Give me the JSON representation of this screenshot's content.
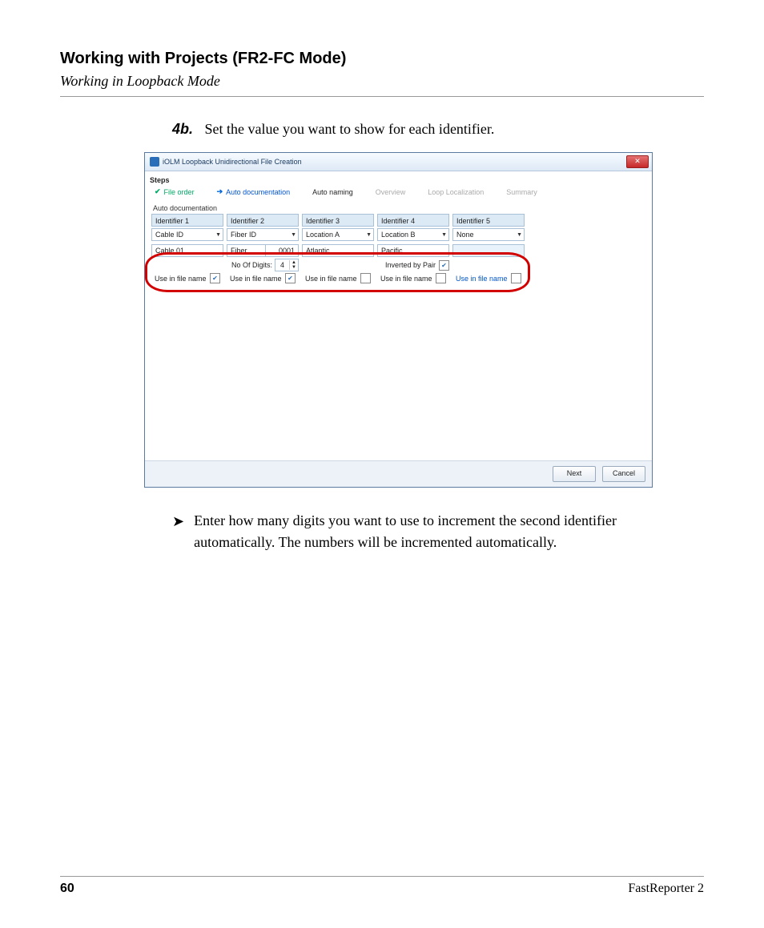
{
  "page": {
    "chapter": "Working with Projects (FR2-FC Mode)",
    "section": "Working in Loopback Mode",
    "step_number": "4b.",
    "step_text": "Set the value you want to show for each identifier.",
    "bullet_text": "Enter how many digits you want to use to increment the second identifier automatically. The numbers will be incremented automatically.",
    "page_number": "60",
    "product": "FastReporter 2"
  },
  "dialog": {
    "title": "iOLM Loopback Unidirectional File Creation",
    "steps_label": "Steps",
    "steps": {
      "file_order": "File order",
      "auto_doc": "Auto documentation",
      "auto_naming": "Auto naming",
      "overview": "Overview",
      "loop_loc": "Loop Localization",
      "summary": "Summary"
    },
    "group": "Auto documentation",
    "headers": {
      "id1": "Identifier 1",
      "id2": "Identifier 2",
      "id3": "Identifier 3",
      "id4": "Identifier 4",
      "id5": "Identifier 5"
    },
    "combo": {
      "c1": "Cable ID",
      "c2": "Fiber ID",
      "c3": "Location A",
      "c4": "Location B",
      "c5": "None"
    },
    "vals": {
      "v1": "Cable 01",
      "v2a": "Fiber",
      "v2b": "0001",
      "v3": "Atlantic",
      "v4": "Pacific",
      "v5": ""
    },
    "digits_label": "No Of Digits:",
    "digits_value": "4",
    "inverted_label": "Inverted by Pair",
    "use_label": "Use in file name",
    "use_checked": {
      "u1": true,
      "u2": true,
      "u3": false,
      "u4": false,
      "u5": false
    },
    "buttons": {
      "next": "Next",
      "cancel": "Cancel"
    }
  }
}
